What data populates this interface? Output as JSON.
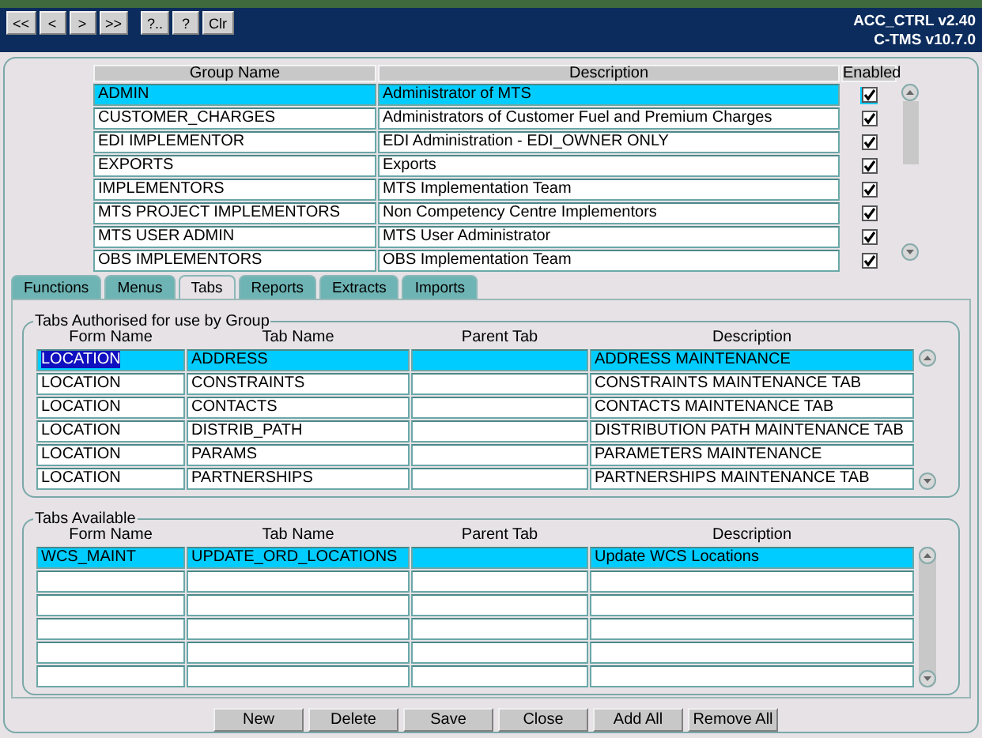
{
  "toolbar": {
    "buttons": [
      "<<",
      "<",
      ">",
      ">>",
      "?..",
      "?",
      "Clr"
    ],
    "version": "ACC_CTRL v2.40",
    "product": "C-TMS v10.7.0"
  },
  "groups": {
    "columns": [
      "Group Name",
      "Description",
      "Enabled"
    ],
    "rows": [
      {
        "name": "ADMIN",
        "description": "Administrator of MTS",
        "enabled": true,
        "selected": true
      },
      {
        "name": "CUSTOMER_CHARGES",
        "description": "Administrators of Customer Fuel and Premium Charges",
        "enabled": true,
        "selected": false
      },
      {
        "name": "EDI IMPLEMENTOR",
        "description": "EDI Administration - EDI_OWNER ONLY",
        "enabled": true,
        "selected": false
      },
      {
        "name": "EXPORTS",
        "description": "Exports",
        "enabled": true,
        "selected": false
      },
      {
        "name": "IMPLEMENTORS",
        "description": "MTS Implementation Team",
        "enabled": true,
        "selected": false
      },
      {
        "name": "MTS PROJECT IMPLEMENTORS",
        "description": "Non Competency Centre Implementors",
        "enabled": true,
        "selected": false
      },
      {
        "name": "MTS USER ADMIN",
        "description": "MTS User Administrator",
        "enabled": true,
        "selected": false
      },
      {
        "name": "OBS IMPLEMENTORS",
        "description": "OBS Implementation Team",
        "enabled": true,
        "selected": false
      }
    ]
  },
  "tabs": [
    {
      "label": "Functions",
      "selected": false
    },
    {
      "label": "Menus",
      "selected": false
    },
    {
      "label": "Tabs",
      "selected": true
    },
    {
      "label": "Reports",
      "selected": false
    },
    {
      "label": "Extracts",
      "selected": false
    },
    {
      "label": "Imports",
      "selected": false
    }
  ],
  "sections": [
    {
      "title": "Tabs Authorised for use by Group",
      "columns": [
        "Form Name",
        "Tab Name",
        "Parent Tab",
        "Description"
      ],
      "rows": [
        {
          "form": "LOCATION",
          "tab": "ADDRESS",
          "description": "ADDRESS MAINTENANCE",
          "selected": true,
          "focused": true
        },
        {
          "form": "LOCATION",
          "tab": "CONSTRAINTS",
          "description": "CONSTRAINTS MAINTENANCE TAB",
          "selected": false,
          "focused": false
        },
        {
          "form": "LOCATION",
          "tab": "CONTACTS",
          "description": "CONTACTS MAINTENANCE TAB",
          "selected": false,
          "focused": false
        },
        {
          "form": "LOCATION",
          "tab": "DISTRIB_PATH",
          "description": "DISTRIBUTION PATH MAINTENANCE TAB",
          "selected": false,
          "focused": false
        },
        {
          "form": "LOCATION",
          "tab": "PARAMS",
          "description": "PARAMETERS MAINTENANCE",
          "selected": false,
          "focused": false
        },
        {
          "form": "LOCATION",
          "tab": "PARTNERSHIPS",
          "description": "PARTNERSHIPS MAINTENANCE TAB",
          "selected": false,
          "focused": false
        }
      ]
    },
    {
      "title": "Tabs Available",
      "columns": [
        "Form Name",
        "Tab Name",
        "Parent Tab",
        "Description"
      ],
      "rows": [
        {
          "form": "WCS_MAINT",
          "tab": "UPDATE_ORD_LOCATIONS",
          "description": "Update WCS Locations",
          "selected": true,
          "focused": false
        }
      ]
    }
  ],
  "buttons": [
    "New",
    "Delete",
    "Save",
    "Close",
    "Add All",
    "Remove All"
  ]
}
